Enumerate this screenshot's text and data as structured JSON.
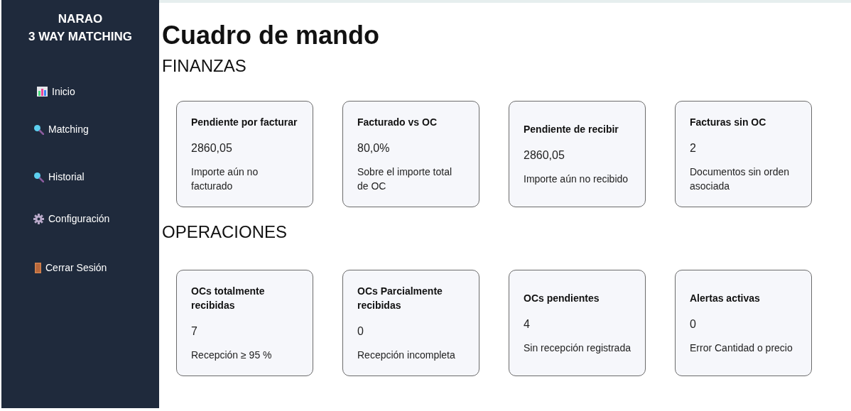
{
  "sidebar": {
    "brand": [
      "NARAO",
      "3 WAY MATCHING"
    ],
    "items": [
      {
        "label": "Inicio",
        "kind": "chart"
      },
      {
        "label": "Matching",
        "kind": "search"
      },
      {
        "label": "Historial",
        "kind": "search"
      },
      {
        "label": "Configuración",
        "kind": "gear"
      },
      {
        "label": "Cerrar Sesión",
        "kind": "door"
      }
    ]
  },
  "title": "Cuadro de mando",
  "sections": [
    {
      "heading": "FINANZAS",
      "cards": [
        {
          "title": "Pendiente por facturar",
          "value": "2860,05",
          "description": "Importe aún no facturado"
        },
        {
          "title": "Facturado vs OC",
          "value": "80,0%",
          "description": "Sobre el importe total de OC"
        },
        {
          "title": "Pendiente de recibir",
          "value": "2860,05",
          "description": "Importe aún no recibido"
        },
        {
          "title": "Facturas sin OC",
          "value": "2",
          "description": "Documentos sin orden asociada"
        }
      ]
    },
    {
      "heading": "OPERACIONES",
      "cards": [
        {
          "title": "OCs totalmente recibidas",
          "value": "7",
          "description": "Recepción ≥ 95 %"
        },
        {
          "title": "OCs Parcialmente recibidas",
          "value": "0",
          "description": "Recepción incompleta"
        },
        {
          "title": "OCs pendientes",
          "value": "4",
          "description": "Sin recepción registrada"
        },
        {
          "title": "Alertas activas",
          "value": "0",
          "description": "Error Cantidad o precio"
        }
      ]
    }
  ]
}
